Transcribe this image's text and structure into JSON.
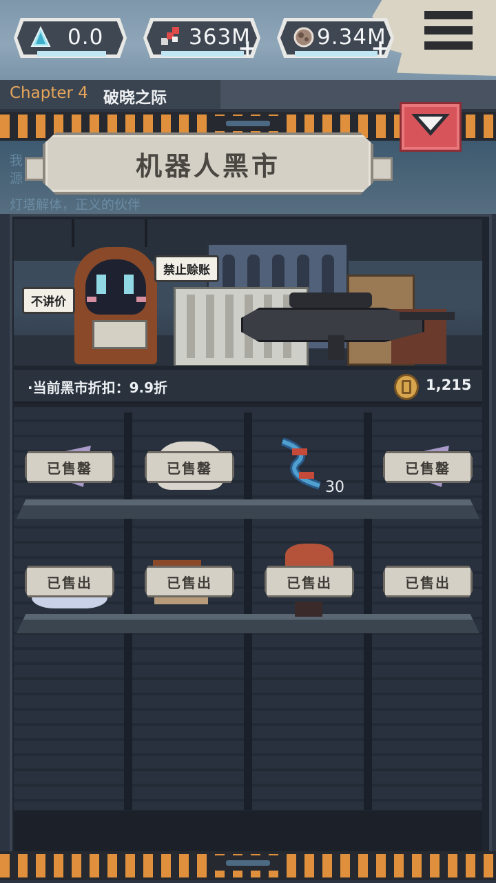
{
  "resources": [
    {
      "name": "crystal-icon",
      "value": "0.0",
      "has_plus": false
    },
    {
      "name": "gene-icon",
      "value": "363M",
      "has_plus": true
    },
    {
      "name": "ore-icon",
      "value": "9.34M",
      "has_plus": true
    }
  ],
  "chapter": {
    "number": "Chapter 4",
    "title": "破晓之际"
  },
  "shop": {
    "title": "机器人黑市",
    "bg_text_1": "我",
    "bg_text_2": "源",
    "bg_text_3": "灯塔解体，正义的伙伴",
    "bubble_1": "禁止赊账",
    "bubble_2": "不讲价",
    "discount_text": "·当前黑市折扣：9.9折",
    "coins": "1,215"
  },
  "items": [
    {
      "name": "item-wing-1",
      "status": "已售罄",
      "count": ""
    },
    {
      "name": "item-box-1",
      "status": "已售罄",
      "count": ""
    },
    {
      "name": "item-dna",
      "status": "",
      "count": "30"
    },
    {
      "name": "item-wing-2",
      "status": "已售罄",
      "count": ""
    },
    {
      "name": "item-robot-unit",
      "status": "已售出",
      "count": ""
    },
    {
      "name": "item-weapon",
      "status": "已售出",
      "count": ""
    },
    {
      "name": "item-girl-unit",
      "status": "已售出",
      "count": ""
    },
    {
      "name": "item-unknown",
      "status": "已售出",
      "count": ""
    }
  ],
  "colors": {
    "accent_orange": "#e0903c",
    "collapse_red": "#d7545a",
    "panel_dark": "#1f252e"
  }
}
